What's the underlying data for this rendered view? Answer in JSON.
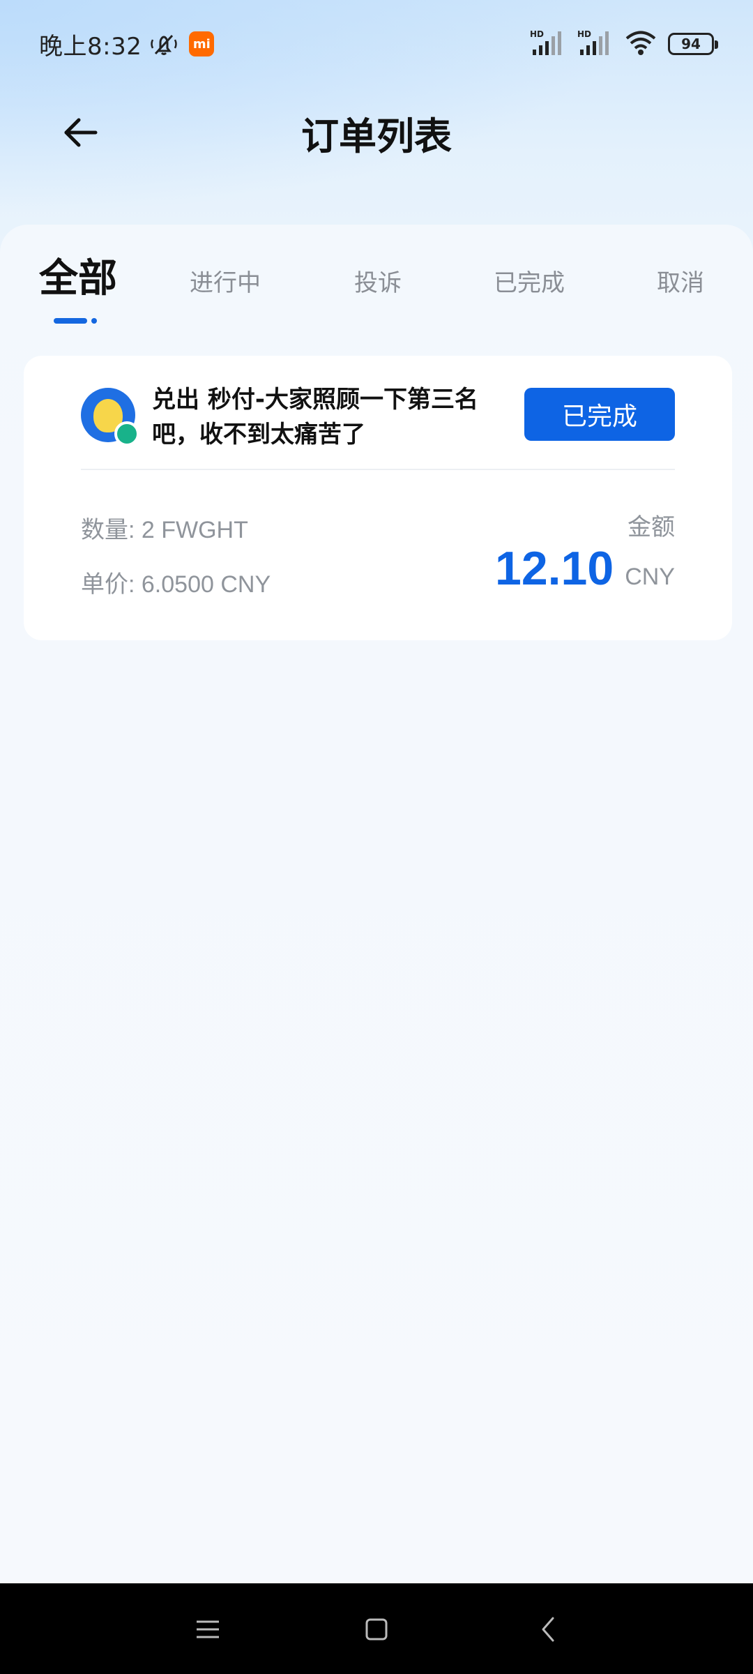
{
  "status_bar": {
    "time": "晚上8:32",
    "mi_badge": "mi",
    "battery": "94",
    "network_1": "HD",
    "network_2": "HD"
  },
  "header": {
    "title": "订单列表",
    "back_icon": "arrow-left-icon"
  },
  "tabs": [
    {
      "label": "全部",
      "active": true
    },
    {
      "label": "进行中",
      "active": false
    },
    {
      "label": "投诉",
      "active": false
    },
    {
      "label": "已完成",
      "active": false
    },
    {
      "label": "取消",
      "active": false
    }
  ],
  "orders": [
    {
      "title": "兑出 秒付-大家照顾一下第三名吧，收不到太痛苦了",
      "status": "已完成",
      "quantity": "数量: 2 FWGHT",
      "unit_price": "单价: 6.0500 CNY",
      "amount_label": "金额",
      "amount": "12.10",
      "currency": "CNY"
    }
  ],
  "colors": {
    "accent": "#0e64e4",
    "online": "#18b28a",
    "muted_text": "#8f949b"
  },
  "nav_bar": {
    "icons": [
      "menu-icon",
      "home-icon",
      "back-icon"
    ]
  }
}
